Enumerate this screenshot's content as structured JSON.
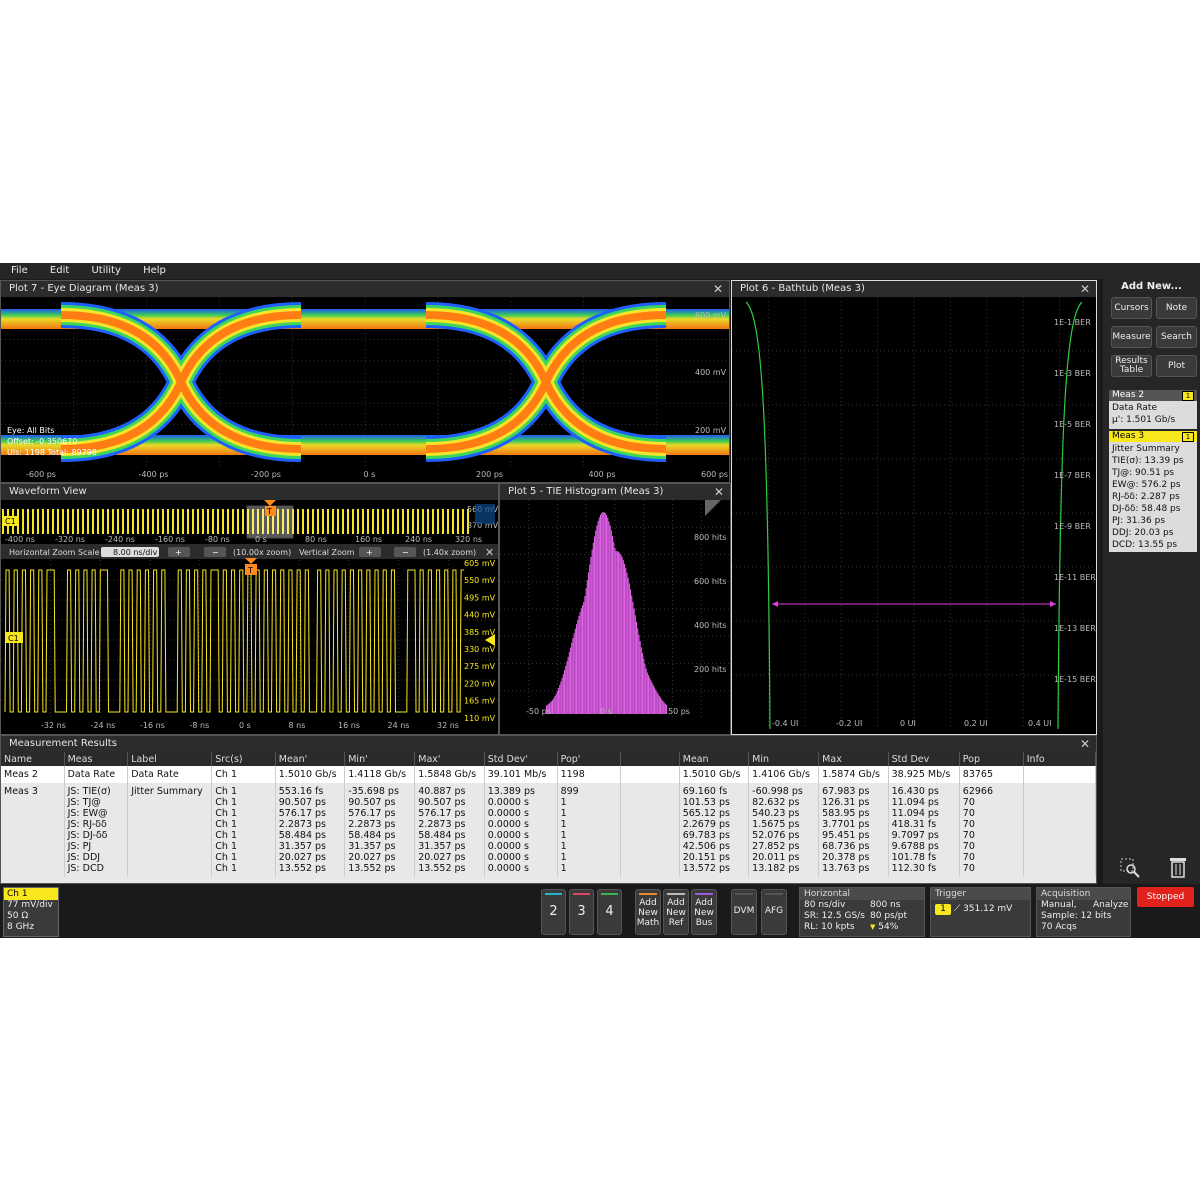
{
  "menu": [
    "File",
    "Edit",
    "Utility",
    "Help"
  ],
  "eye": {
    "title": "Plot 7 - Eye Diagram (Meas 3)",
    "xticks": [
      "-600 ps",
      "-400 ps",
      "-200 ps",
      "0 s",
      "200 ps",
      "400 ps",
      "600 ps"
    ],
    "yticks": [
      "600 mV",
      "400 mV",
      "200 mV"
    ],
    "info": [
      "Eye:  All Bits",
      "Offset: -0.350670",
      "UIs: 1198   Total: 89798"
    ]
  },
  "bathtub": {
    "title": "Plot 6 - Bathtub (Meas 3)",
    "yticks": [
      "1E-1 BER",
      "1E-3 BER",
      "1E-5 BER",
      "1E-7 BER",
      "1E-9 BER",
      "1E-11 BER",
      "1E-13 BER",
      "1E-15 BER"
    ],
    "xticks": [
      "-0.4 UI",
      "-0.2 UI",
      "0 UI",
      "0.2 UI",
      "0.4 UI"
    ]
  },
  "waveform": {
    "title": "Waveform View",
    "overview_ticks": [
      "-400 ns",
      "-320 ns",
      "-240 ns",
      "-160 ns",
      "-80 ns",
      "0 s",
      "80 ns",
      "160 ns",
      "240 ns",
      "320 ns"
    ],
    "overview_y": [
      "560 mV",
      "370 mV"
    ],
    "zoom": {
      "hscale_label": "Horizontal Zoom Scale",
      "hscale_value": "8.00 ns/div",
      "hzoom": "(10.00x zoom)",
      "vscale_label": "Vertical Zoom",
      "vzoom": "(1.40x zoom)"
    },
    "xticks": [
      "-32 ns",
      "-24 ns",
      "-16 ns",
      "-8 ns",
      "0 s",
      "8 ns",
      "16 ns",
      "24 ns",
      "32 ns"
    ],
    "yticks": [
      "605 mV",
      "550 mV",
      "495 mV",
      "440 mV",
      "385 mV",
      "330 mV",
      "275 mV",
      "220 mV",
      "165 mV",
      "110 mV"
    ],
    "ch_label": "C1",
    "trigger_label": "T"
  },
  "histogram": {
    "title": "Plot 5 - TIE Histogram (Meas 3)",
    "yticks": [
      "800 hits",
      "600 hits",
      "400 hits",
      "200 hits"
    ],
    "xticks": [
      "-50 ps",
      "0 s",
      "50 ps"
    ]
  },
  "sidebar": {
    "header": "Add New...",
    "buttons": [
      "Cursors",
      "Note",
      "Measure",
      "Search",
      "Results Table",
      "Plot"
    ],
    "meas2": {
      "title": "Meas 2",
      "badge": "1",
      "lines": [
        "Data Rate",
        "μ': 1.501 Gb/s"
      ]
    },
    "meas3": {
      "title": "Meas 3",
      "badge": "1",
      "lines": [
        "Jitter Summary",
        "TIE(σ): 13.39 ps",
        "TJ@: 90.51 ps",
        "EW@: 576.2 ps",
        "RJ-δδ: 2.287 ps",
        "DJ-δδ: 58.48 ps",
        "PJ: 31.36 ps",
        "DDJ: 20.03 ps",
        "DCD: 13.55 ps"
      ]
    }
  },
  "results": {
    "title": "Measurement Results",
    "headers": [
      "Name",
      "Meas",
      "Label",
      "Src(s)",
      "Mean'",
      "Min'",
      "Max'",
      "Std Dev'",
      "Pop'",
      "",
      "Mean",
      "Min",
      "Max",
      "Std Dev",
      "Pop",
      "Info"
    ],
    "rows": [
      {
        "name": "Meas 2",
        "meas": [
          "Data Rate"
        ],
        "label": "Data Rate",
        "src": [
          "Ch 1"
        ],
        "mean1": [
          "1.5010 Gb/s"
        ],
        "min1": [
          "1.4118 Gb/s"
        ],
        "max1": [
          "1.5848 Gb/s"
        ],
        "std1": [
          "39.101 Mb/s"
        ],
        "pop1": [
          "1198"
        ],
        "mean": [
          "1.5010 Gb/s"
        ],
        "min": [
          "1.4106 Gb/s"
        ],
        "max": [
          "1.5874 Gb/s"
        ],
        "std": [
          "38.925 Mb/s"
        ],
        "pop": [
          "83765"
        ]
      },
      {
        "name": "Meas 3",
        "meas": [
          "JS: TIE(σ)",
          "JS: TJ@",
          "JS: EW@",
          "JS: RJ-δδ",
          "JS: DJ-δδ",
          "JS: PJ",
          "JS: DDJ",
          "JS: DCD"
        ],
        "label": "Jitter Summary",
        "src": [
          "Ch 1",
          "Ch 1",
          "Ch 1",
          "Ch 1",
          "Ch 1",
          "Ch 1",
          "Ch 1",
          "Ch 1"
        ],
        "mean1": [
          "553.16 fs",
          "90.507 ps",
          "576.17 ps",
          "2.2873 ps",
          "58.484 ps",
          "31.357 ps",
          "20.027 ps",
          "13.552 ps"
        ],
        "min1": [
          "-35.698 ps",
          "90.507 ps",
          "576.17 ps",
          "2.2873 ps",
          "58.484 ps",
          "31.357 ps",
          "20.027 ps",
          "13.552 ps"
        ],
        "max1": [
          "40.887 ps",
          "90.507 ps",
          "576.17 ps",
          "2.2873 ps",
          "58.484 ps",
          "31.357 ps",
          "20.027 ps",
          "13.552 ps"
        ],
        "std1": [
          "13.389 ps",
          "0.0000 s",
          "0.0000 s",
          "0.0000 s",
          "0.0000 s",
          "0.0000 s",
          "0.0000 s",
          "0.0000 s"
        ],
        "pop1": [
          "899",
          "1",
          "1",
          "1",
          "1",
          "1",
          "1",
          "1"
        ],
        "mean": [
          "69.160 fs",
          "101.53 ps",
          "565.12 ps",
          "2.2679 ps",
          "69.783 ps",
          "42.506 ps",
          "20.151 ps",
          "13.572 ps"
        ],
        "min": [
          "-60.998 ps",
          "82.632 ps",
          "540.23 ps",
          "1.5675 ps",
          "52.076 ps",
          "27.852 ps",
          "20.011 ps",
          "13.182 ps"
        ],
        "max": [
          "67.983 ps",
          "126.31 ps",
          "583.95 ps",
          "3.7701 ps",
          "95.451 ps",
          "68.736 ps",
          "20.378 ps",
          "13.763 ps"
        ],
        "std": [
          "16.430 ps",
          "11.094 ps",
          "11.094 ps",
          "418.31 fs",
          "9.7097 ps",
          "9.6788 ps",
          "101.78 fs",
          "112.30 fs"
        ],
        "pop": [
          "62966",
          "70",
          "70",
          "70",
          "70",
          "70",
          "70",
          "70"
        ]
      }
    ]
  },
  "bottom": {
    "ch1": {
      "title": "Ch 1",
      "lines": [
        "77 mV/div",
        "50 Ω",
        "8 GHz"
      ]
    },
    "channels": [
      "2",
      "3",
      "4"
    ],
    "channel_colors": [
      "#21b6c9",
      "#e0456a",
      "#39b54a"
    ],
    "add_buttons": [
      [
        "Add",
        "New",
        "Math"
      ],
      [
        "Add",
        "New",
        "Ref"
      ],
      [
        "Add",
        "New",
        "Bus"
      ]
    ],
    "add_colors": [
      "#e08a2a",
      "#bbbbbb",
      "#9b59d6"
    ],
    "tools": [
      "DVM",
      "AFG"
    ],
    "horizontal": {
      "title": "Horizontal",
      "lines": [
        [
          "80 ns/div",
          "800 ns"
        ],
        [
          "SR: 12.5 GS/s",
          "80 ps/pt"
        ],
        [
          "RL: 10 kpts",
          "54%"
        ]
      ]
    },
    "trigger": {
      "title": "Trigger",
      "source": "1",
      "level": "351.12 mV"
    },
    "acquisition": {
      "title": "Acquisition",
      "lines": [
        [
          "Manual,",
          "Analyze"
        ],
        [
          "Sample: 12 bits",
          ""
        ],
        [
          "70 Acqs",
          ""
        ]
      ]
    },
    "status": "Stopped"
  },
  "colors": {
    "ch1": "#f8e71c",
    "hist": "#e060e8",
    "bathtub": "#2ecc40",
    "marker": "#e040e0"
  }
}
